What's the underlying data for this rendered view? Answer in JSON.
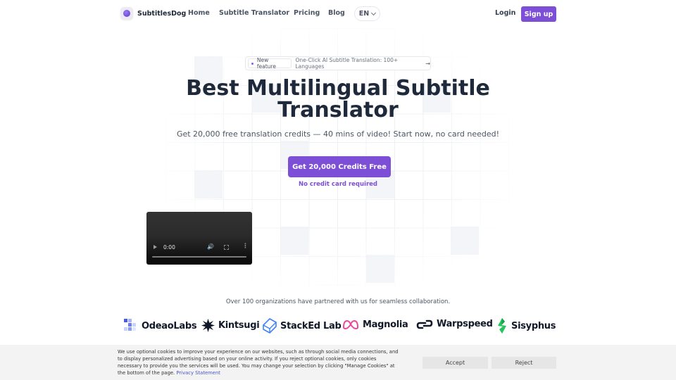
{
  "header": {
    "brand": "SubtitlesDog",
    "nav": [
      {
        "label": "Home"
      },
      {
        "label": "Subtitle Translator"
      },
      {
        "label": "Pricing"
      },
      {
        "label": "Blog"
      }
    ],
    "language": "EN",
    "login_label": "Login",
    "signup_label": "Sign up"
  },
  "announcement": {
    "badge": "New feature",
    "text": "One-Click AI Subtitle Translation: 100+ Languages",
    "arrow": "→"
  },
  "hero": {
    "title_line1": "Best Multilingual Subtitle",
    "title_line2": "Translator",
    "subtitle": "Get 20,000 free translation credits — 40 mins of video! Start now, no card needed!",
    "cta_label": "Get 20,000 Credits Free",
    "cta_note": "No credit card required"
  },
  "video": {
    "time": "0:00",
    "progress": 0
  },
  "partners": {
    "text": "Over 100 organizations have partnered with us for seamless collaboration.",
    "logos": [
      {
        "name": "OdeaoLabs",
        "icon": "pixel-squares-icon",
        "color": "#5b6cf0"
      },
      {
        "name": "Kintsugi",
        "icon": "starburst-icon",
        "color": "#111827"
      },
      {
        "name": "StackEd Lab",
        "icon": "stacked-hexagon-icon",
        "color": "#3b82f6"
      },
      {
        "name": "Magnolia",
        "icon": "infinity-loops-icon",
        "color": "#ec4899"
      },
      {
        "name": "Warpspeed",
        "icon": "link-loop-icon",
        "color": "#111827"
      },
      {
        "name": "Sisyphus",
        "icon": "bolt-leaf-icon",
        "color": "#22c55e"
      }
    ]
  },
  "cookie": {
    "text": "We use optional cookies to improve your experience on our websites, such as through social media connections, and to display personalized advertising based on your online activity. If you reject optional cookies, only cookies necessary to provide you the services will be used. You may change your selection by clicking \"Manage Cookies\" at the bottom of the page.",
    "link": "Privacy Statement",
    "accept_label": "Accept",
    "reject_label": "Reject"
  },
  "colors": {
    "accent": "#7c4fd6",
    "heading": "#1e293b"
  }
}
